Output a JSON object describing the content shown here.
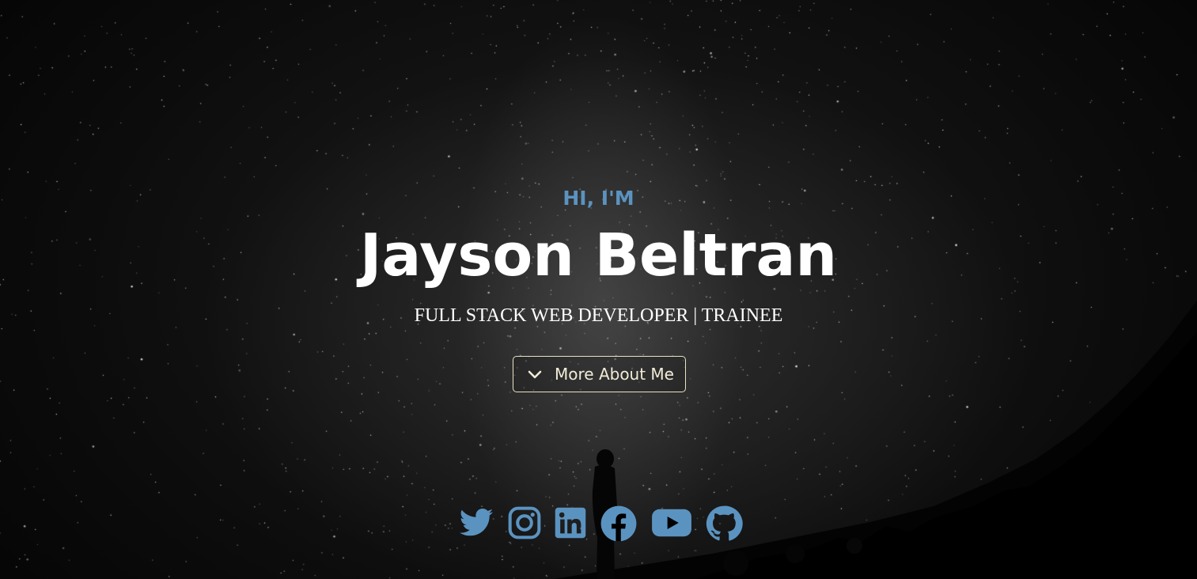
{
  "hero": {
    "greeting": "HI, I'M",
    "name": "Jayson Beltran",
    "subtitle": "FULL STACK WEB DEVELOPER | TRAINEE",
    "cta_label": "More About Me"
  },
  "social_links": [
    {
      "name": "twitter",
      "icon": "twitter-icon"
    },
    {
      "name": "instagram",
      "icon": "instagram-icon"
    },
    {
      "name": "linkedin",
      "icon": "linkedin-icon"
    },
    {
      "name": "facebook",
      "icon": "facebook-icon"
    },
    {
      "name": "youtube",
      "icon": "youtube-icon"
    },
    {
      "name": "github",
      "icon": "github-icon"
    }
  ],
  "colors": {
    "accent": "#5b93c0",
    "name_text": "#ffffff",
    "button_border": "#e9e2c4",
    "background": "#000000"
  }
}
